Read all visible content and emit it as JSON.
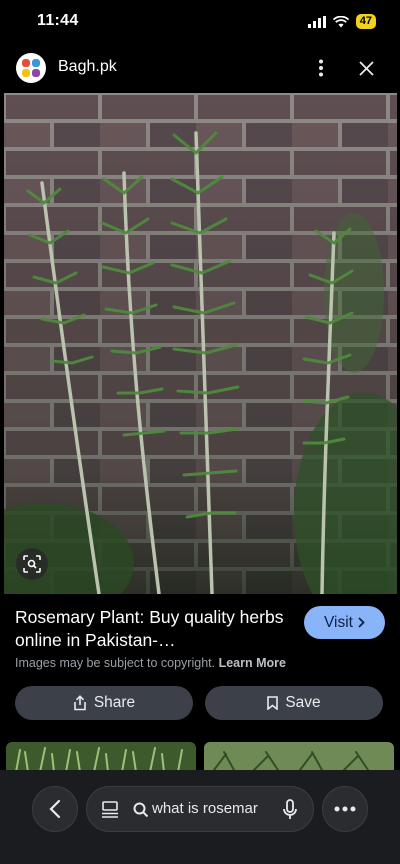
{
  "status": {
    "time": "11:44",
    "battery": "47"
  },
  "header": {
    "site_name": "Bagh.pk"
  },
  "result": {
    "title": "Rosemary Plant: Buy quality herbs online in Pakistan-…",
    "visit_label": "Visit",
    "copyright_text": "Images may be subject to copyright.",
    "learn_more": "Learn More",
    "share_label": "Share",
    "save_label": "Save"
  },
  "search": {
    "query": "what is rosemar"
  },
  "colors": {
    "visit_button": "#8ab4f8",
    "battery": "#f2d31c",
    "action_button": "#3c4048"
  },
  "icons": [
    "signal-icon",
    "wifi-icon",
    "more-vert-icon",
    "close-icon",
    "lens-icon",
    "share-icon",
    "bookmark-icon",
    "back-icon",
    "tabs-icon",
    "search-icon",
    "mic-icon",
    "more-horiz-icon"
  ]
}
